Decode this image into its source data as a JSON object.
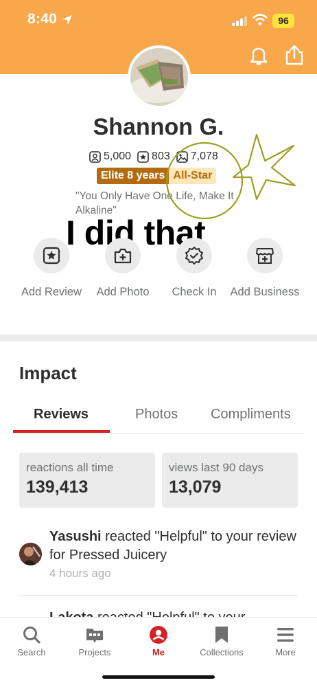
{
  "status_bar": {
    "time": "8:40",
    "battery": "96"
  },
  "profile": {
    "name": "Shannon G.",
    "friends": "5,000",
    "reviews": "803",
    "photos": "7,078",
    "elite_badge": "Elite 8 years",
    "allstar_badge": "All-Star",
    "quote": "\"You Only Have One Life, Make It Alkaline\""
  },
  "overlay_text": "I did that",
  "actions": [
    {
      "label": "Add Review",
      "icon": "star-review-icon"
    },
    {
      "label": "Add Photo",
      "icon": "camera-plus-icon"
    },
    {
      "label": "Check In",
      "icon": "check-badge-icon"
    },
    {
      "label": "Add Business",
      "icon": "storefront-plus-icon"
    }
  ],
  "impact": {
    "title": "Impact",
    "tabs": [
      "Reviews",
      "Photos",
      "Compliments"
    ],
    "active_tab": "Reviews",
    "cards": [
      {
        "label": "reactions all time",
        "value": "139,413"
      },
      {
        "label": "views last 90 days",
        "value": "13,079"
      }
    ]
  },
  "activity": [
    {
      "user": "Yasushi",
      "text": " reacted \"Helpful\" to your review for Pressed Juicery",
      "time": "4 hours ago"
    },
    {
      "user": "Lakota",
      "text": " reacted \"Helpful\" to your"
    }
  ],
  "tabbar": [
    {
      "label": "Search",
      "icon": "search-icon"
    },
    {
      "label": "Projects",
      "icon": "projects-icon"
    },
    {
      "label": "Me",
      "icon": "me-icon",
      "active": true
    },
    {
      "label": "Collections",
      "icon": "bookmark-icon"
    },
    {
      "label": "More",
      "icon": "menu-icon"
    }
  ],
  "colors": {
    "header": "#f8a84b",
    "accent_red": "#d32323",
    "elite": "#b36b12",
    "annotation": "#9aa022"
  }
}
